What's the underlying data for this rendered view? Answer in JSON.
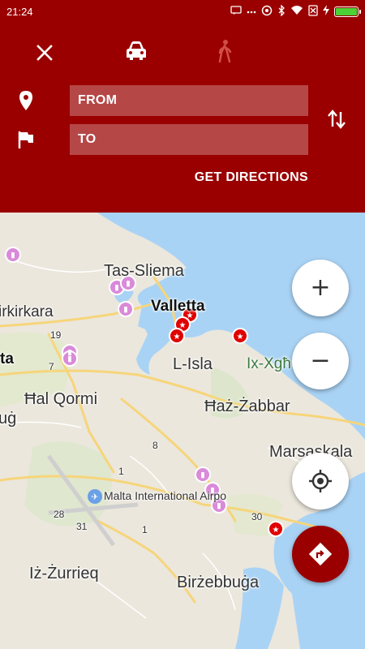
{
  "status_bar": {
    "time": "21:24",
    "colors": {
      "background": "#9a0000",
      "battery": "#4cd137"
    },
    "icons": [
      "message-icon",
      "more-icon",
      "data-saver-icon",
      "bluetooth-icon",
      "wifi-icon",
      "sim-off-icon",
      "charging-icon",
      "battery-icon"
    ],
    "battery_level": 1.0
  },
  "header": {
    "colors": {
      "background": "#9a0000"
    },
    "transport_modes": [
      {
        "name": "car",
        "icon": "car-icon",
        "selected": true
      },
      {
        "name": "walk",
        "icon": "walk-icon",
        "selected": false
      }
    ],
    "from_placeholder": "FROM",
    "to_placeholder": "TO",
    "get_directions_label": "GET DIRECTIONS"
  },
  "map": {
    "labels": {
      "tas_sliema": "Tas-Sliema",
      "birkirkara": "irkirkara",
      "valletta": "Valletta",
      "l_isla": "L-Isla",
      "ix_xghajra": "Ix-Xgħ",
      "hal_qormi": "Ħal Qormi",
      "haz_zabbar": "Ħaż-Żabbar",
      "marsaskala": "Marsaskala",
      "airport": "Malta International Airpo",
      "iz_zurrieq": "Iż-Żurrieq",
      "birzebbuga": "Birżebbuġa",
      "ta": "ta",
      "lug": "uġ",
      "road_19": "19",
      "road_7": "7",
      "road_8": "8",
      "road_1a": "1",
      "road_28": "28",
      "road_31": "31",
      "road_1b": "1",
      "road_30": "30"
    },
    "marker_colors": {
      "fuel": "#d98ad9",
      "poi": "#e00000"
    }
  },
  "controls": {
    "zoom_in": "+",
    "zoom_out": "−",
    "my_location_icon": "my-location-icon",
    "directions_icon": "directions-icon",
    "directions_color": "#9a0000"
  }
}
